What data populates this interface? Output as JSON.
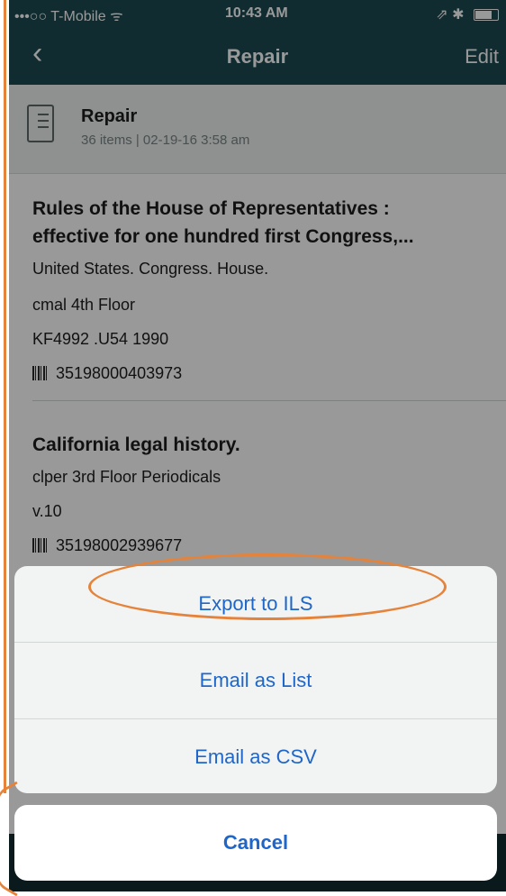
{
  "status_bar": {
    "carrier": "•••○○ T-Mobile ᯤ",
    "time": "10:43 AM",
    "right": "⇗ ✱"
  },
  "nav": {
    "back_label": "‹",
    "title": "Repair",
    "edit_label": "Edit"
  },
  "list": {
    "name": "Repair",
    "meta": "36 items  |  02-19-16 3:58 am"
  },
  "items": [
    {
      "title": "Rules of the House of Representatives : effective for one hundred first Congress,...",
      "title_line1": "Rules of the House of Representatives :",
      "title_line2": "effective for one hundred first Congress,...",
      "author": "United States. Congress. House.",
      "location": "cmal  4th Floor",
      "call_number": "KF4992 .U54 1990",
      "barcode": "35198000403973"
    },
    {
      "title": "California legal history.",
      "location": "clper 3rd Floor Periodicals",
      "volume": " v.10",
      "barcode": "35198002939677"
    }
  ],
  "action_sheet": {
    "buttons": [
      "Export to ILS",
      "Email as List",
      "Email as CSV"
    ],
    "cancel_label": "Cancel"
  },
  "colors": {
    "nav_bg": "#1c4a50",
    "action_blue": "#1e66c9",
    "annotation_orange": "#e6833a"
  }
}
